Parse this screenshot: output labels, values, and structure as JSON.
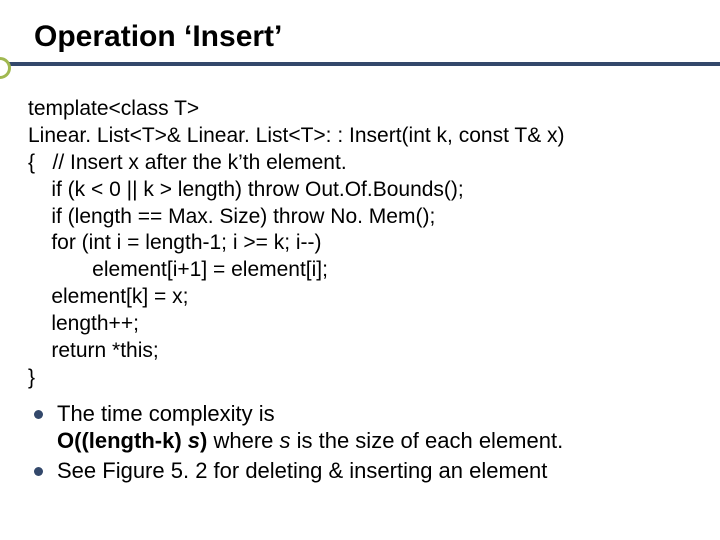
{
  "title": "Operation ‘Insert’",
  "code": {
    "l0": "template<class T>",
    "l1": "Linear. List<T>& Linear. List<T>: : Insert(int k, const T& x)",
    "l2": "{   // Insert x after the k’th element.",
    "l3": "    if (k < 0 || k > length) throw Out.Of.Bounds();",
    "l4": "    if (length == Max. Size) throw No. Mem();",
    "l5": "    for (int i = length-1; i >= k; i--)",
    "l6": "           element[i+1] = element[i];",
    "l7": "    element[k] = x;",
    "l8": "    length++;",
    "l9": "    return *this;",
    "l10": "}"
  },
  "notes": {
    "n1a": "The time complexity is",
    "n1b_prefix": "O((length-k) ",
    "n1b_s1": "s",
    "n1b_paren": ")",
    "n1b_where": " where ",
    "n1b_s2": "s",
    "n1b_tail": " is the size of each element.",
    "n2": "See Figure 5. 2 for deleting & inserting an element"
  }
}
